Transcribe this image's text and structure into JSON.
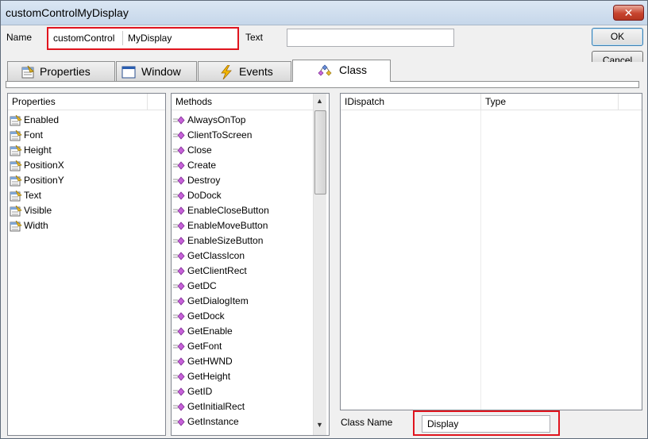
{
  "window": {
    "title": "customControlMyDisplay",
    "close_glyph": "✕"
  },
  "name_field": {
    "label": "Name",
    "prefix": "customControl",
    "value": "MyDisplay"
  },
  "text_field": {
    "label": "Text",
    "value": ""
  },
  "buttons": {
    "ok": "OK",
    "cancel": "Cancel"
  },
  "tabs": [
    {
      "label": "Properties",
      "icon": "properties-icon"
    },
    {
      "label": "Window",
      "icon": "window-icon"
    },
    {
      "label": "Events",
      "icon": "lightning-icon"
    },
    {
      "label": "Class",
      "icon": "class-icon",
      "active": true
    }
  ],
  "properties_panel": {
    "header": "Properties",
    "items": [
      "Enabled",
      "Font",
      "Height",
      "PositionX",
      "PositionY",
      "Text",
      "Visible",
      "Width"
    ]
  },
  "methods_panel": {
    "header": "Methods",
    "items": [
      "AlwaysOnTop",
      "ClientToScreen",
      "Close",
      "Create",
      "Destroy",
      "DoDock",
      "EnableCloseButton",
      "EnableMoveButton",
      "EnableSizeButton",
      "GetClassIcon",
      "GetClientRect",
      "GetDC",
      "GetDialogItem",
      "GetDock",
      "GetEnable",
      "GetFont",
      "GetHWND",
      "GetHeight",
      "GetID",
      "GetInitialRect",
      "GetInstance"
    ]
  },
  "idispatch_panel": {
    "headers": [
      "IDispatch",
      "Type"
    ]
  },
  "class_name": {
    "label": "Class Name",
    "value": "Display"
  },
  "colors": {
    "highlight_border": "#e0141e",
    "title_bar": "#c6d7ea"
  }
}
